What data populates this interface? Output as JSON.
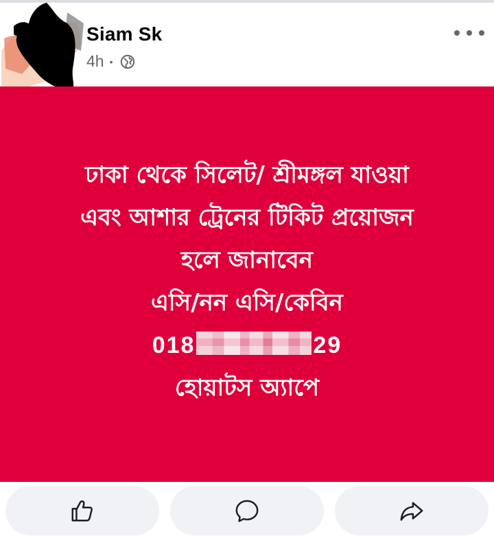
{
  "post": {
    "author": "Siam Sk",
    "time": "4h",
    "separator": "•",
    "privacy_icon": "globe-icon",
    "more_icon": "more-dots-icon",
    "background_color": "#df003b",
    "text_lines": [
      "ঢাকা থেকে সিলেট/ শ্রীমঙ্গল  যাওয়া",
      "এবং আশার ট্রেনের টিকিট প্রয়োজন",
      "হলে জানাবেন",
      "এসি/নন এসি/কেবিন"
    ],
    "phone_prefix": "018",
    "phone_suffix": "29",
    "closing_line": "হোয়াটস অ্যাপে"
  },
  "actions": {
    "like_icon": "thumbs-up-icon",
    "comment_icon": "comment-bubble-icon",
    "share_icon": "share-arrow-icon"
  }
}
